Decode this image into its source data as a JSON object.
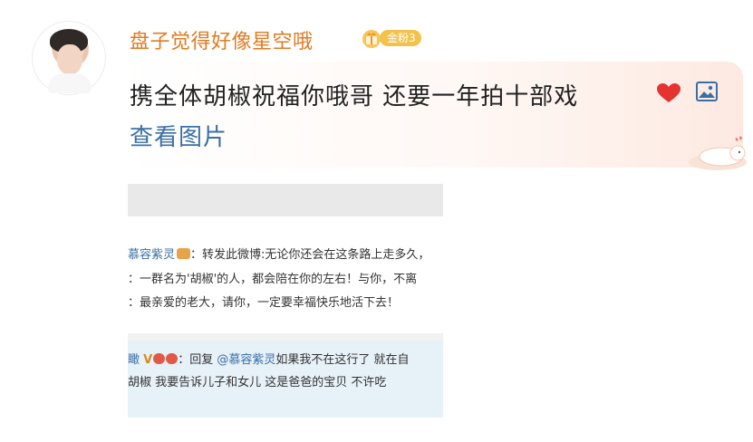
{
  "post": {
    "username": "盘子觉得好像星空哦",
    "badge_label": "金粉3",
    "content": "携全体胡椒祝福你哦哥 还要一年拍十部戏",
    "view_images": "查看图片"
  },
  "embedded_screenshot": {
    "comment1": {
      "author": "慕容紫灵",
      "line1": "：转发此微博:无论你还会在这条路上走多久，",
      "line2_prefix": "：一群名为'胡椒'的人，都会陪在你的左右！与你，不离",
      "line3_prefix": "：最亲爱的老大，请你，一定要幸福快乐地活下去！"
    },
    "comment2": {
      "author": "瞰",
      "reply_prefix": "：回复",
      "mention": "@慕容紫灵",
      "reply_text": "如果我不在这行了 就在自",
      "line2": "胡椒 我要告诉儿子和女儿 这是爸爸的宝贝 不许吃"
    }
  },
  "icons": {
    "heart": "heart-icon",
    "image": "image-icon",
    "badge": "gift-badge-icon",
    "decor": "cute-animal-sticker"
  },
  "colors": {
    "username": "#e07b23",
    "link": "#3a6fa6",
    "heart": "#e3342f",
    "badge": "#f3c24a"
  }
}
